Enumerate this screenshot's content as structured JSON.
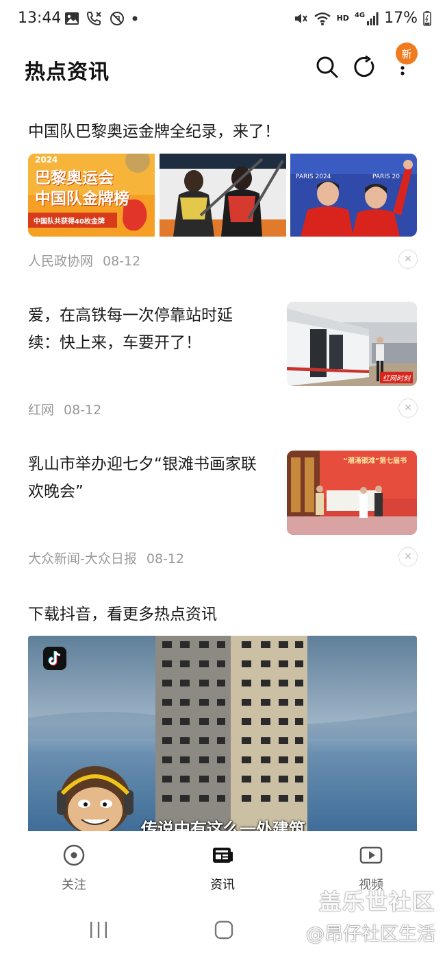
{
  "status_bar": {
    "time": "13:44",
    "network": "HD",
    "signal": "4G",
    "battery": "17%"
  },
  "header": {
    "title": "热点资讯",
    "new_badge": "新",
    "badge_color": "#f07a1e"
  },
  "articles": [
    {
      "title": "中国队巴黎奥运金牌全纪录，来了！",
      "source": "人民政协网",
      "date": "08-12",
      "images": [
        {
          "caption_year": "2024",
          "caption_line1": "巴黎奥运会",
          "caption_line2": "中国队金牌榜",
          "caption_line3": "中国队共获得40枚金牌"
        },
        {},
        {}
      ]
    },
    {
      "title_line1": "爱，在高铁每一次停靠站时延",
      "title_line2": "续：快上来，车要开了！",
      "source": "红网",
      "date": "08-12",
      "thumb_label": "红网时刻"
    },
    {
      "title_line1": "乳山市举办迎七夕“银滩书画家联",
      "title_line2": "欢晚会”",
      "source": "大众新闻-大众日报",
      "date": "08-12",
      "thumb_text": "“潮涌银滩”第七届书"
    }
  ],
  "promo": {
    "title": "下载抖音，看更多热点资讯",
    "video_subtitle": "传说中有这么一处建筑"
  },
  "bottom_nav": [
    {
      "label": "关注",
      "icon": "target-icon",
      "active": false
    },
    {
      "label": "资讯",
      "icon": "news-icon",
      "active": true
    },
    {
      "label": "视频",
      "icon": "play-icon",
      "active": false
    }
  ],
  "watermark": {
    "line1": "盖乐世社区",
    "line2": "@昂仔社区生活"
  }
}
